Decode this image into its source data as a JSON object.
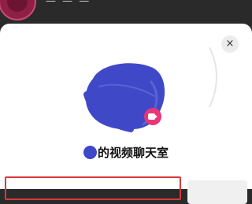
{
  "header": {
    "obscured_text": "—  —  —"
  },
  "dialog": {
    "close_glyph": "×",
    "title": "的视频聊天室"
  },
  "colors": {
    "backdrop": "#2a2a2a",
    "scribble": "#3f48c7",
    "camera_badge": "#e8367a",
    "highlight_box": "#d63a3a"
  },
  "icons": {
    "close": "close-icon",
    "camera": "video-camera-icon"
  }
}
